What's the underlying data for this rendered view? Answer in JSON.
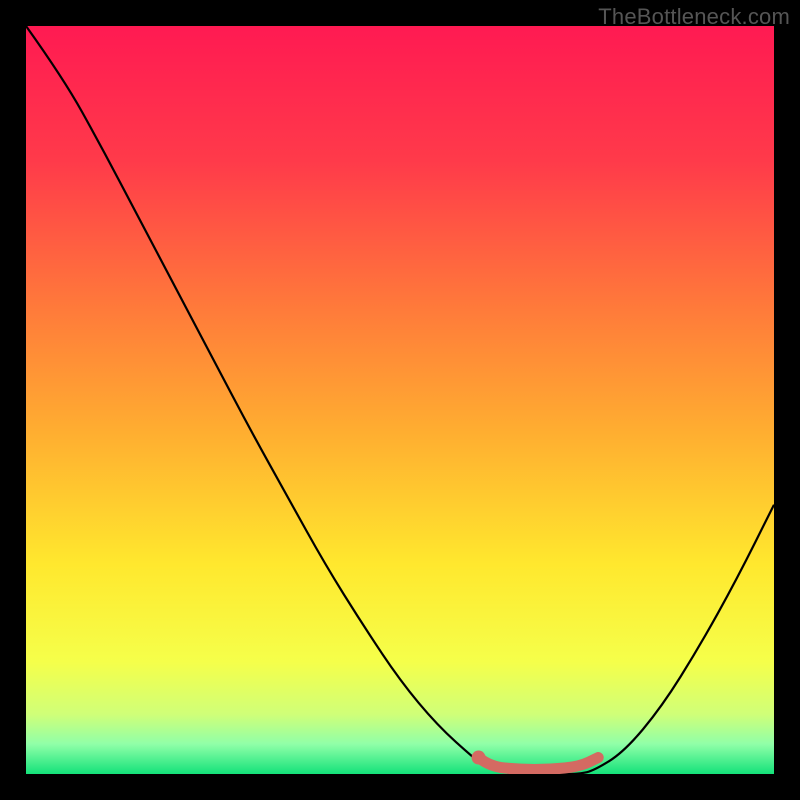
{
  "watermark": "TheBottleneck.com",
  "chart_data": {
    "type": "line",
    "title": "",
    "xlabel": "",
    "ylabel": "",
    "xlim": [
      0,
      100
    ],
    "ylim": [
      0,
      100
    ],
    "series": [
      {
        "name": "bottleneck-curve",
        "x": [
          0,
          5,
          10,
          15,
          20,
          25,
          30,
          35,
          40,
          45,
          50,
          55,
          60,
          62,
          66,
          70,
          74,
          76,
          80,
          85,
          90,
          95,
          100
        ],
        "y": [
          100,
          93,
          84,
          74.5,
          65,
          55.5,
          46,
          37,
          28,
          20,
          12.5,
          6.5,
          2,
          0.5,
          0,
          0,
          0,
          0.5,
          3,
          9,
          17,
          26,
          36
        ],
        "color": "#000000"
      },
      {
        "name": "accent-plateau",
        "x": [
          60.5,
          62,
          66,
          70,
          74,
          76.5
        ],
        "y": [
          2.2,
          1,
          0.6,
          0.6,
          1,
          2.2
        ],
        "color": "#d46a62"
      }
    ],
    "gradient_stops": [
      {
        "offset": 0,
        "color": "#ff1a52"
      },
      {
        "offset": 18,
        "color": "#ff3a4a"
      },
      {
        "offset": 38,
        "color": "#ff7b3a"
      },
      {
        "offset": 55,
        "color": "#ffb030"
      },
      {
        "offset": 72,
        "color": "#ffe82e"
      },
      {
        "offset": 85,
        "color": "#f5ff4a"
      },
      {
        "offset": 92,
        "color": "#d0ff78"
      },
      {
        "offset": 96,
        "color": "#90ffa8"
      },
      {
        "offset": 100,
        "color": "#14e27a"
      }
    ],
    "accent_dot": {
      "x": 60.5,
      "y": 2.2,
      "color": "#d46a62"
    }
  }
}
